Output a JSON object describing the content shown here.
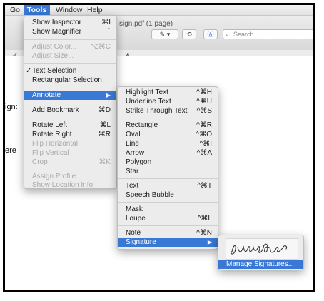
{
  "menubar": {
    "items": [
      "Go",
      "Tools",
      "Window",
      "Help"
    ],
    "active": "Tools"
  },
  "toolbar": {
    "doc_title": "sign.pdf (1 page)",
    "search_placeholder": "Search"
  },
  "document": {
    "label_sign": "ign:",
    "label_here": "ere"
  },
  "tools_menu": {
    "show_inspector": "Show Inspector",
    "show_inspector_sc": "⌘I",
    "show_magnifier": "Show Magnifier",
    "show_magnifier_sc": "`",
    "adjust_color": "Adjust Color...",
    "adjust_color_sc": "⌥⌘C",
    "adjust_size": "Adjust Size...",
    "text_selection": "Text Selection",
    "rect_selection": "Rectangular Selection",
    "annotate": "Annotate",
    "add_bookmark": "Add Bookmark",
    "add_bookmark_sc": "⌘D",
    "rotate_left": "Rotate Left",
    "rotate_left_sc": "⌘L",
    "rotate_right": "Rotate Right",
    "rotate_right_sc": "⌘R",
    "flip_horizontal": "Flip Horizontal",
    "flip_vertical": "Flip Vertical",
    "crop": "Crop",
    "crop_sc": "⌘K",
    "assign_profile": "Assign Profile...",
    "show_location": "Show Location Info"
  },
  "annotate_menu": {
    "highlight": "Highlight Text",
    "highlight_sc": "^⌘H",
    "underline": "Underline Text",
    "underline_sc": "^⌘U",
    "strike": "Strike Through Text",
    "strike_sc": "^⌘S",
    "rectangle": "Rectangle",
    "rectangle_sc": "^⌘R",
    "oval": "Oval",
    "oval_sc": "^⌘O",
    "line": "Line",
    "line_sc": "^⌘I",
    "arrow": "Arrow",
    "arrow_sc": "^⌘A",
    "polygon": "Polygon",
    "star": "Star",
    "text": "Text",
    "text_sc": "^⌘T",
    "speech_bubble": "Speech Bubble",
    "mask": "Mask",
    "loupe": "Loupe",
    "loupe_sc": "^⌘L",
    "note": "Note",
    "note_sc": "^⌘N",
    "signature": "Signature"
  },
  "signature_menu": {
    "manage": "Manage Signatures..."
  },
  "colors": {
    "accent": "#3a78d6",
    "menu_bg": "#ececec",
    "disabled": "#a9a9a9"
  }
}
